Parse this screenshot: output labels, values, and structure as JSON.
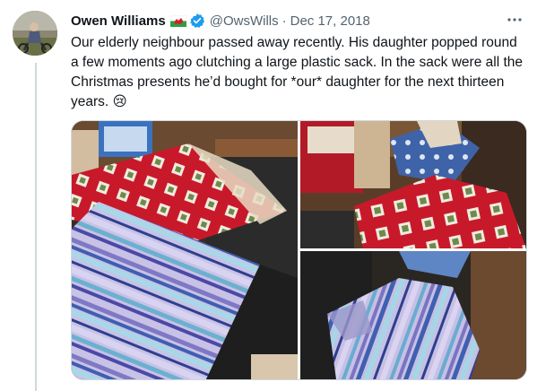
{
  "tweet": {
    "display_name": "Owen Williams",
    "handle": "@OwsWills",
    "separator": "·",
    "date": "Dec 17, 2018",
    "text": "Our elderly neighbour passed away recently. His daughter popped round a few moments ago clutching a large plastic sack. In the sack were all the Christmas presents he’d bought for *our* daughter for the next thirteen years. 😢",
    "more_icon": "more-icon",
    "flag_icon": "welsh-flag-icon",
    "verified_icon": "verified-badge-icon",
    "verified_color": "#1d9bf0"
  },
  "media": {
    "photos": [
      {
        "name": "photo-presents-1"
      },
      {
        "name": "photo-presents-2"
      },
      {
        "name": "photo-presents-3"
      }
    ]
  },
  "colors": {
    "text_primary": "#0f1419",
    "text_secondary": "#536471",
    "border": "#cfd9de"
  }
}
